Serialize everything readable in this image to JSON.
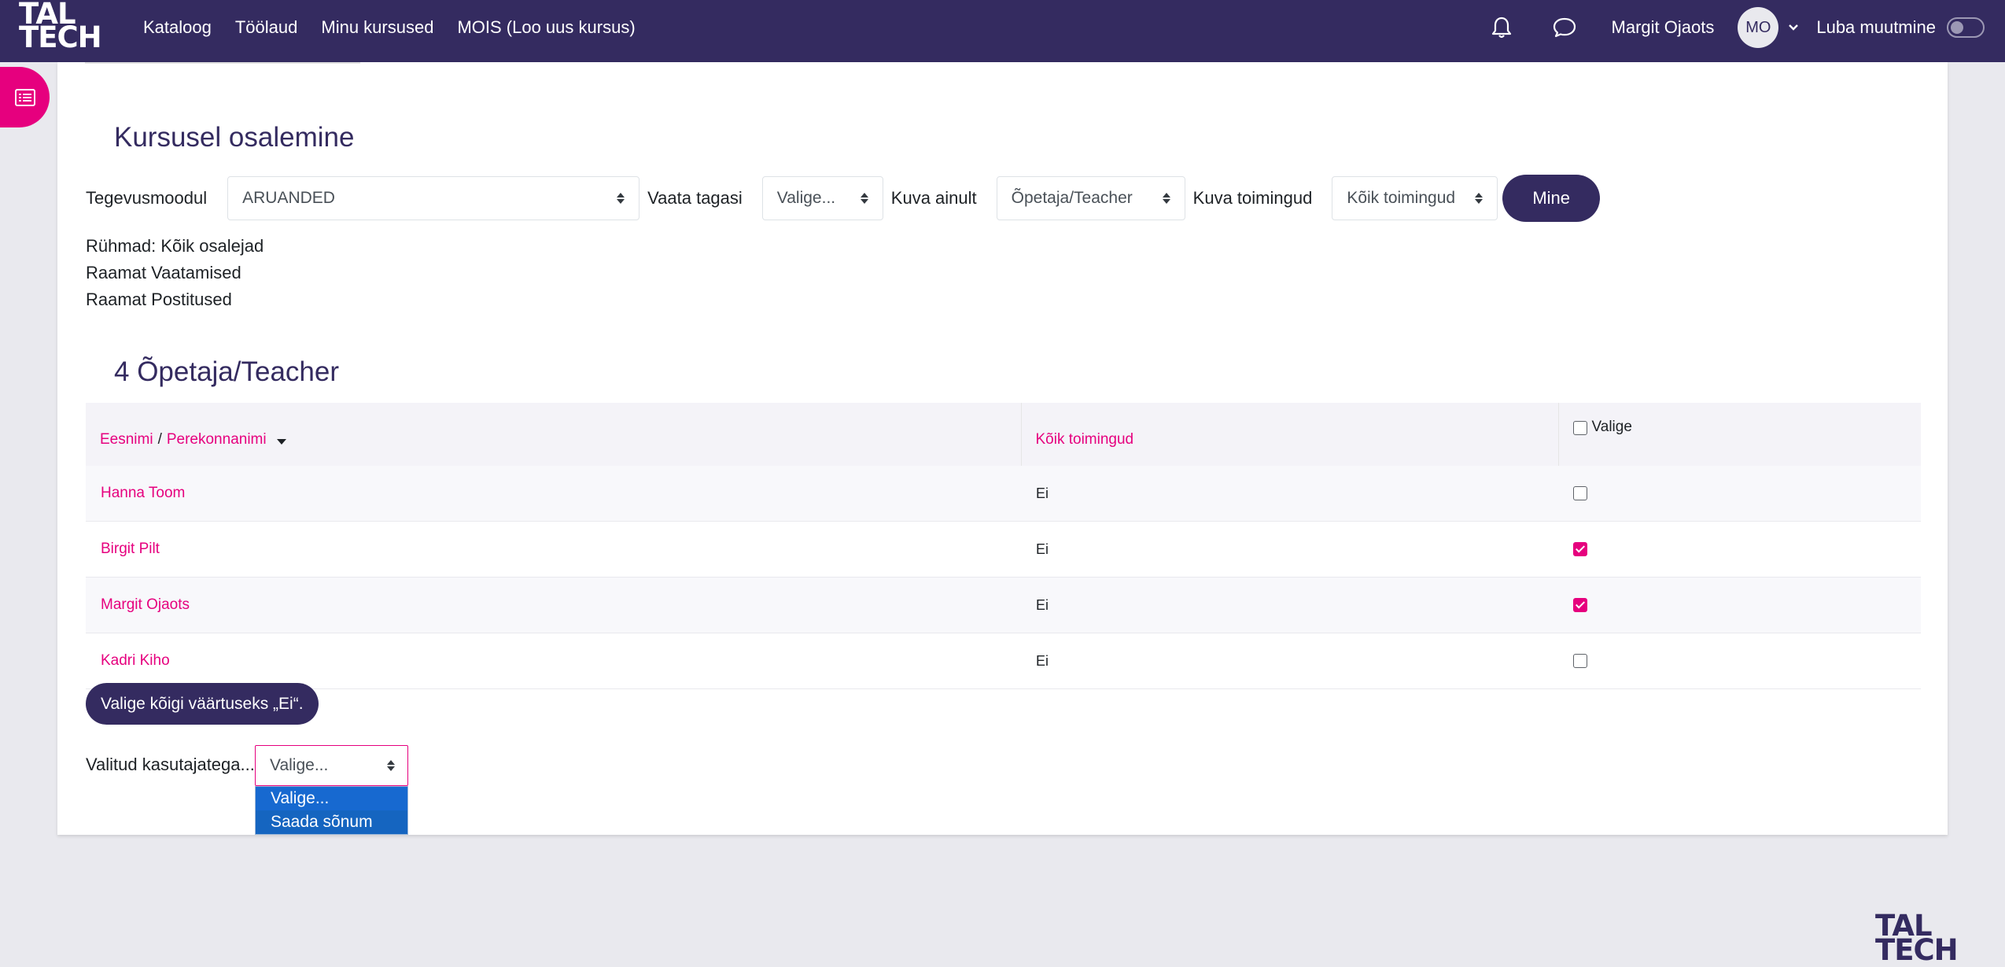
{
  "brand": {
    "line1": "TAL",
    "line2": "TECH"
  },
  "nav": {
    "links": [
      "Kataloog",
      "Töölaud",
      "Minu kursused",
      "MOIS (Loo uus kursus)"
    ],
    "user_name": "Margit Ojaots",
    "avatar_initials": "MO",
    "edit_mode_label": "Luba muutmine",
    "edit_mode_on": false
  },
  "page": {
    "title": "Kursusel osalemine",
    "filters": {
      "module_label": "Tegevusmoodul",
      "module_value": "ARUANDED",
      "lookback_label": "Vaata tagasi",
      "lookback_value": "Valige...",
      "show_only_label": "Kuva ainult",
      "show_only_value": "Õpetaja/Teacher",
      "actions_label": "Kuva toimingud",
      "actions_value": "Kõik toimingud",
      "go_button": "Mine"
    },
    "info": [
      "Rühmad: Kõik osalejad",
      "Raamat Vaatamised",
      "Raamat Postitused"
    ],
    "section_title": "4 Õpetaja/Teacher",
    "table": {
      "col_first_name": "Eesnimi",
      "col_separator": "/",
      "col_last_name": "Perekonnanimi",
      "col_actions": "Kõik toimingud",
      "col_select": "Valige",
      "rows": [
        {
          "name": "Hanna Toom",
          "value": "Ei",
          "selected": false
        },
        {
          "name": "Birgit Pilt",
          "value": "Ei",
          "selected": true
        },
        {
          "name": "Margit Ojaots",
          "value": "Ei",
          "selected": true
        },
        {
          "name": "Kadri Kiho",
          "value": "Ei",
          "selected": false
        }
      ]
    },
    "select_all_button": "Valige kõigi väärtuseks „Ei“.",
    "bulk": {
      "label": "Valitud kasutajatega...",
      "value": "Valige...",
      "options": [
        "Valige...",
        "Saada sõnum"
      ]
    }
  },
  "footer": {
    "logo_line1": "TAL",
    "logo_line2": "TECH"
  },
  "colors": {
    "navbar": "#342b60",
    "accent": "#e6007e",
    "primary_button": "#342b60"
  }
}
